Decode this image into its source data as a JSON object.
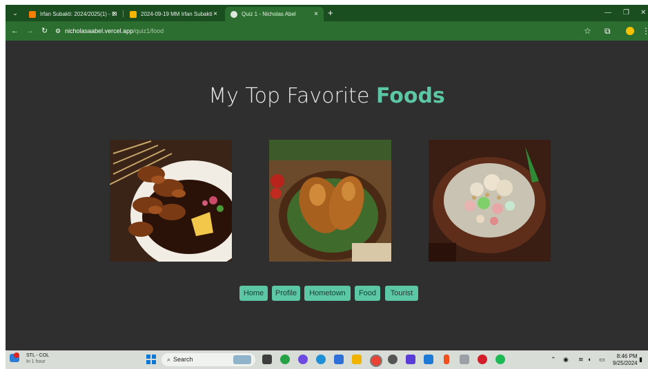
{
  "browser": {
    "tabs": [
      {
        "title": "Irfan Subakti: 2024/2025(1) - EI",
        "favicon": "blogger-icon",
        "active": false
      },
      {
        "title": "2024-09-19 MM Irfan Subakti",
        "favicon": "google-drive-icon",
        "active": false
      },
      {
        "title": "Quiz 1 - Nicholas Abel",
        "favicon": "globe-icon",
        "active": true
      }
    ],
    "close_glyph": "×",
    "new_tab_glyph": "+",
    "address": {
      "domain": "nicholasaabel.vercel.app",
      "path": "/quiz1/food"
    }
  },
  "page": {
    "heading_plain": "My Top Favorite",
    "heading_accent": "Foods",
    "images": [
      {
        "name": "satay-image",
        "alt": "Satay skewers"
      },
      {
        "name": "fried-chicken-image",
        "alt": "Fried chicken"
      },
      {
        "name": "dessert-bowl-image",
        "alt": "Dessert bowl"
      }
    ],
    "nav_buttons": [
      "Home",
      "Profile",
      "Hometown",
      "Food",
      "Tourist"
    ]
  },
  "taskbar": {
    "weather_title": "STL - COL",
    "weather_sub": "In 1 hour",
    "search_label": "Search",
    "time": "8:46 PM",
    "date": "9/25/2024"
  },
  "colors": {
    "accent": "#5cc7a4",
    "page_bg": "#2f2f2f",
    "chrome_green": "#2c6e2f"
  }
}
